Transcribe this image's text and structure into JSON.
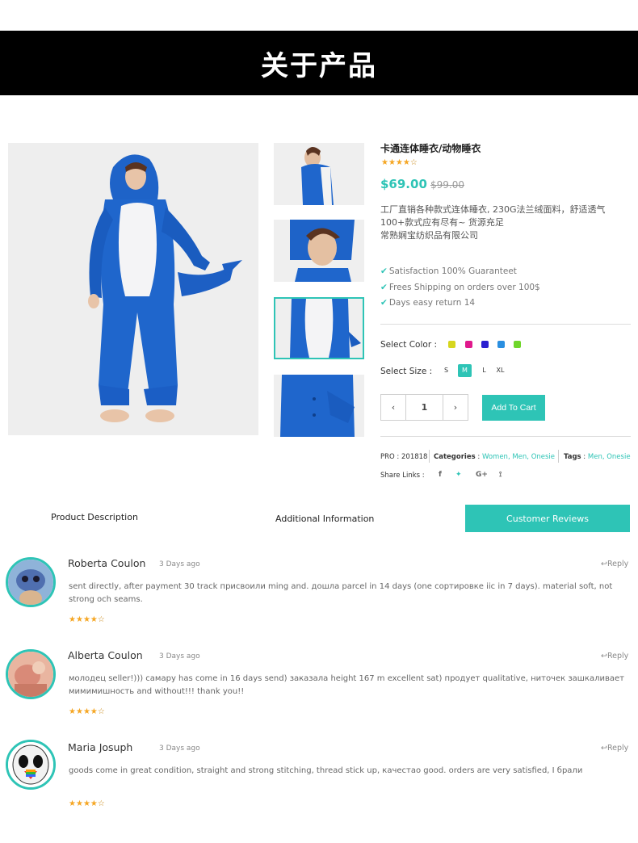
{
  "banner": {
    "title": "关于产品"
  },
  "product": {
    "title": "卡通连体睡衣/动物睡衣",
    "rating": 4.5,
    "price": "$69.00",
    "old_price": "$99.00",
    "description": [
      "工厂直销各种款式连体睡衣, 230G法兰绒面料，舒适透气",
      "100+款式应有尽有~ 货源充足",
      "常熟娴宝纺织品有限公司"
    ],
    "features": [
      "Satisfaction 100% Guaranteet",
      "Frees Shipping on orders over 100$",
      "Days easy return 14"
    ],
    "select_color_label": "Select Color :",
    "colors": [
      "#d6d61e",
      "#e0198c",
      "#2a1fd0",
      "#2a8fe0",
      "#6fd62a"
    ],
    "select_size_label": "Select Size :",
    "sizes": [
      "S",
      "M",
      "L",
      "XL"
    ],
    "selected_size": "M",
    "quantity": "1",
    "add_to_cart": "Add To Cart",
    "pro_label": "PRO",
    "pro_value": "201818",
    "categories_label": "Categories",
    "categories": "Women,  Men,  Onesie",
    "tags_label": "Tags",
    "tags": "Men,  Onesie",
    "share_label": "Share  Links :",
    "share_icons": [
      "f",
      "t",
      "G+",
      "rss"
    ]
  },
  "tabs": {
    "description": "Product  Description",
    "additional": "Additional  Information",
    "reviews": "Customer  Reviews"
  },
  "reviews": [
    {
      "name": "Roberta Coulon",
      "date": "3 Days ago",
      "reply": "Reply",
      "text": "sent directly, after payment 30 track присвоили ming and. дошла parcel in 14 days (one сортировке iic in 7 days). material soft, not strong och seams.",
      "rating": 4.5
    },
    {
      "name": "Alberta Coulon",
      "date": "3 Days ago",
      "reply": "Reply",
      "text": "молодец seller!))) самару has come in 16 days send) заказала height 167 m excellent sat) продует qualitative, ниточек зашкаливает мимимишность and without!!! thank you!!",
      "rating": 4.5
    },
    {
      "name": "Maria Josuph",
      "date": "3 Days ago",
      "reply": "Reply",
      "text": "goods come in great condition, straight and strong stitching, thread stick up, качестао good. orders are very satisfied, I брали",
      "rating": 4.5
    }
  ]
}
